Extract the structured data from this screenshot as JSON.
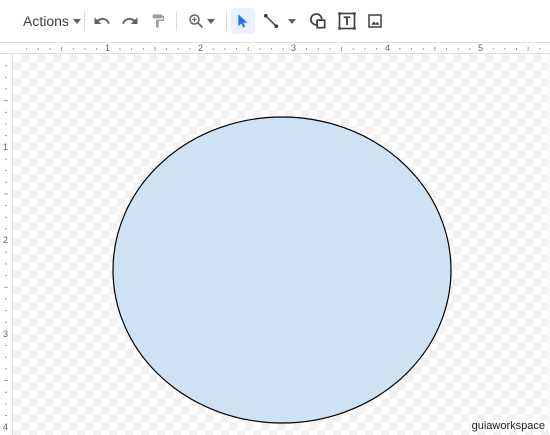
{
  "toolbar": {
    "actions_label": "Actions",
    "tools": [
      {
        "name": "undo",
        "icon": "undo-icon"
      },
      {
        "name": "redo",
        "icon": "redo-icon"
      },
      {
        "name": "paint-format",
        "icon": "paint-format-icon"
      },
      {
        "name": "zoom",
        "icon": "zoom-icon"
      },
      {
        "name": "select",
        "icon": "cursor-arrow-icon",
        "active": true
      },
      {
        "name": "line",
        "icon": "line-icon"
      },
      {
        "name": "shape",
        "icon": "shape-icon"
      },
      {
        "name": "text-box",
        "icon": "text-box-icon"
      },
      {
        "name": "image",
        "icon": "image-icon"
      }
    ]
  },
  "ruler": {
    "horizontal_labels": [
      "1",
      "2",
      "3",
      "4",
      "5"
    ],
    "vertical_labels": [
      "1",
      "2",
      "3",
      "4"
    ]
  },
  "canvas": {
    "shape": "ellipse",
    "fill_color": "#cfe2f3",
    "stroke_color": "#000000"
  },
  "watermark": "guiaworkspace",
  "colors": {
    "accent": "#1a73e8",
    "active_bg": "#e8f0fe",
    "icon": "#5f6368"
  }
}
